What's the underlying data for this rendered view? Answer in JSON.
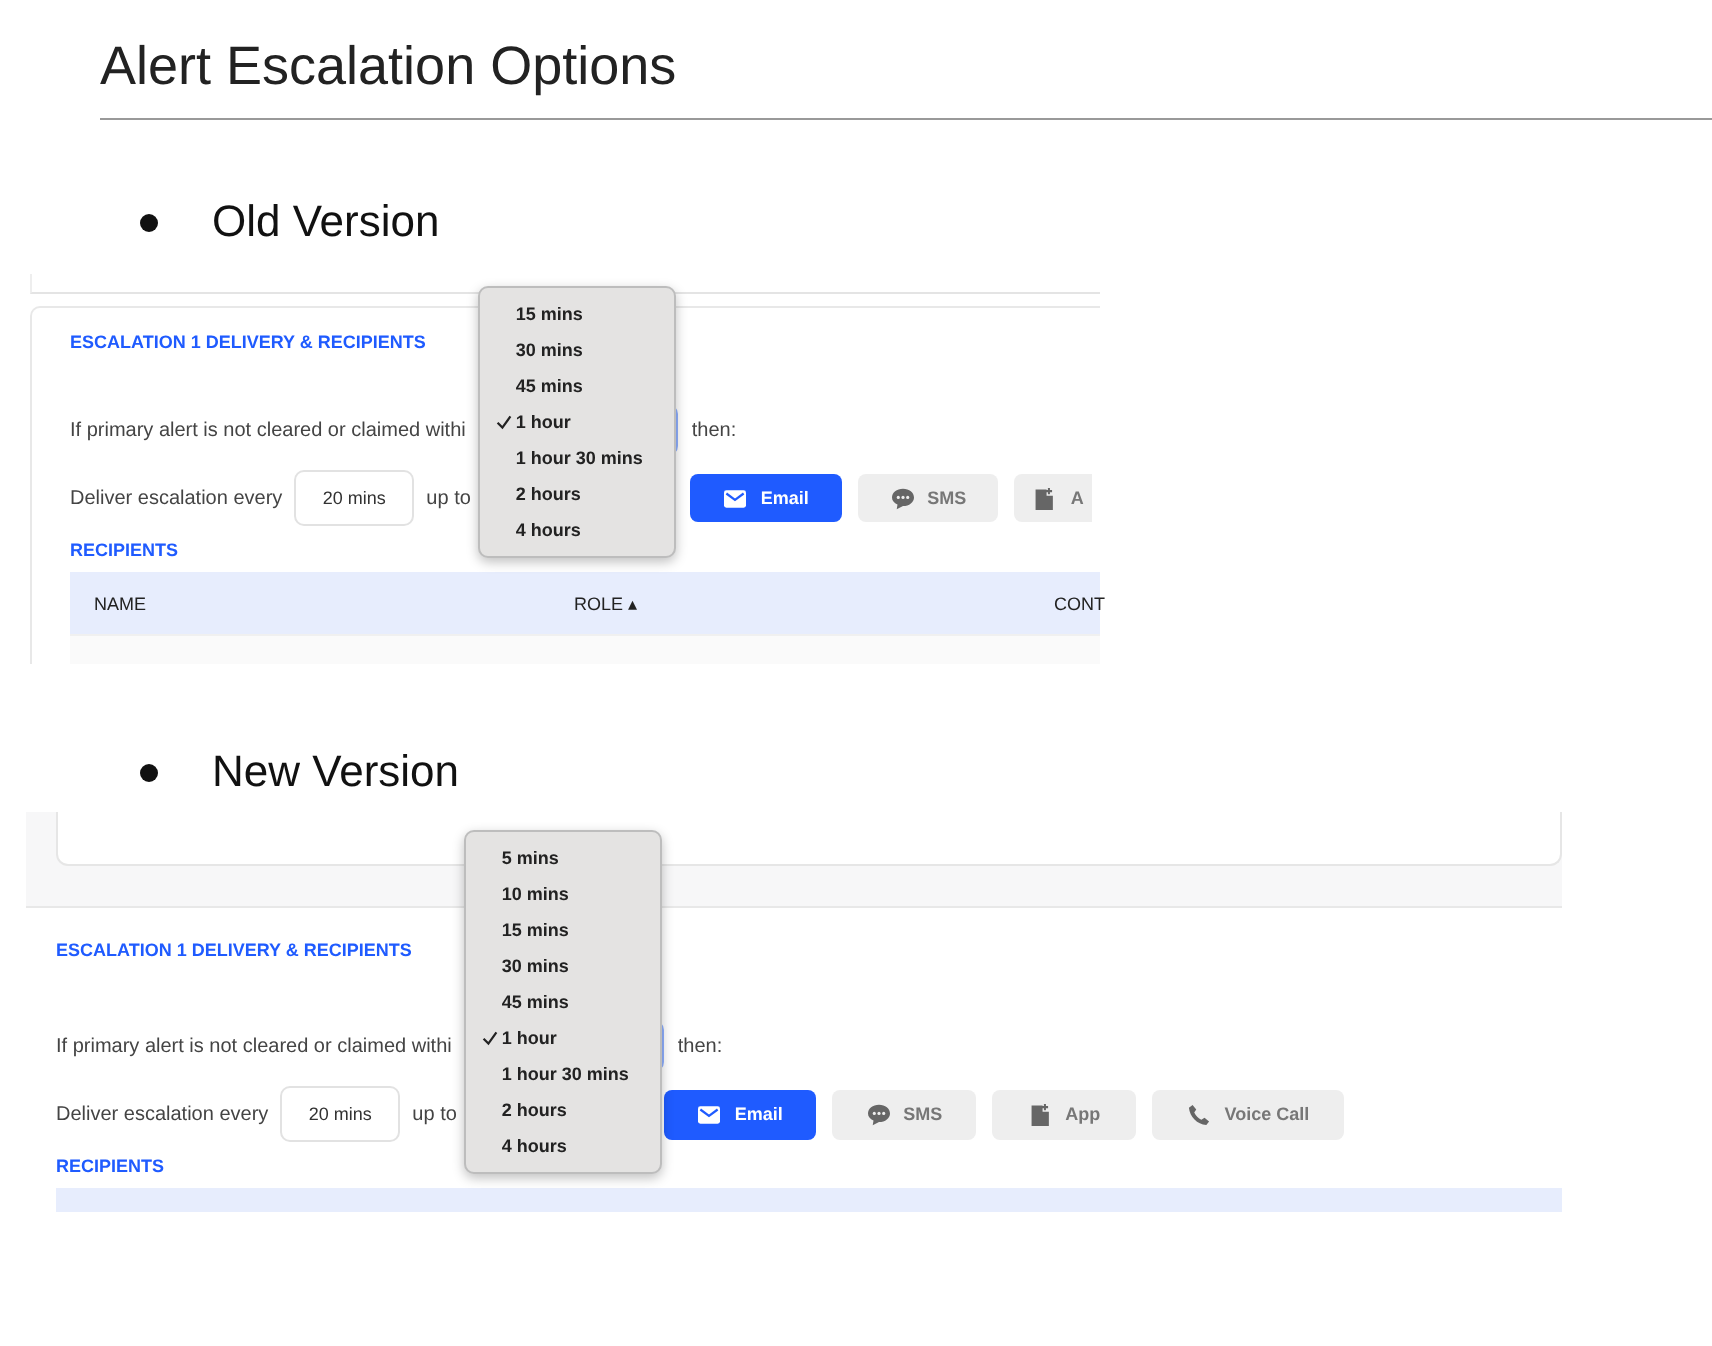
{
  "title": "Alert Escalation Options",
  "sections": [
    {
      "bullet": "Old Version",
      "screenshot": {
        "heading": "ESCALATION 1 DELIVERY & RECIPIENTS",
        "condition_text": "If primary alert is not cleared or claimed withi",
        "then_text": "then:",
        "deliver_label": "Deliver escalation every",
        "interval": "20 mins",
        "up_to": "up to",
        "channels": [
          {
            "label": "Email",
            "kind": "email",
            "selected": true
          },
          {
            "label": "SMS",
            "kind": "sms",
            "selected": false
          },
          {
            "label": "A",
            "kind": "app",
            "selected": false
          }
        ],
        "recipients_heading": "RECIPIENTS",
        "columns": [
          "NAME",
          "ROLE ▴",
          "CONT"
        ],
        "dropdown": [
          {
            "label": "15 mins",
            "checked": false
          },
          {
            "label": "30 mins",
            "checked": false
          },
          {
            "label": "45 mins",
            "checked": false
          },
          {
            "label": "1 hour",
            "checked": true
          },
          {
            "label": "1 hour 30 mins",
            "checked": false
          },
          {
            "label": "2 hours",
            "checked": false
          },
          {
            "label": "4 hours",
            "checked": false
          }
        ]
      }
    },
    {
      "bullet": "New Version",
      "screenshot": {
        "heading": "ESCALATION 1 DELIVERY & RECIPIENTS",
        "condition_text": "If primary alert is not cleared or claimed withi",
        "then_text": "then:",
        "deliver_label": "Deliver escalation every",
        "interval": "20 mins",
        "up_to": "up to",
        "channels": [
          {
            "label": "Email",
            "kind": "email",
            "selected": true
          },
          {
            "label": "SMS",
            "kind": "sms",
            "selected": false
          },
          {
            "label": "App",
            "kind": "app",
            "selected": false
          },
          {
            "label": "Voice Call",
            "kind": "voice",
            "selected": false
          }
        ],
        "recipients_heading": "RECIPIENTS",
        "dropdown": [
          {
            "label": "5 mins",
            "checked": false
          },
          {
            "label": "10 mins",
            "checked": false
          },
          {
            "label": "15 mins",
            "checked": false
          },
          {
            "label": "30 mins",
            "checked": false
          },
          {
            "label": "45 mins",
            "checked": false
          },
          {
            "label": "1 hour",
            "checked": true
          },
          {
            "label": "1 hour 30 mins",
            "checked": false
          },
          {
            "label": "2 hours",
            "checked": false
          },
          {
            "label": "4 hours",
            "checked": false
          }
        ]
      }
    }
  ]
}
